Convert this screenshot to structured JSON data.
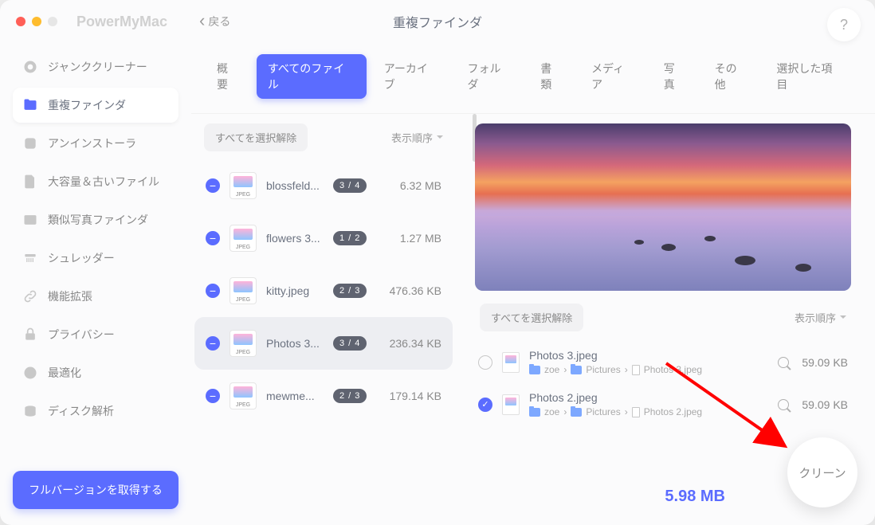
{
  "app_title": "PowerMyMac",
  "back_label": "戻る",
  "page_title": "重複ファインダ",
  "help_label": "?",
  "sidebar": {
    "items": [
      {
        "label": "ジャンククリーナー"
      },
      {
        "label": "重複ファインダ"
      },
      {
        "label": "アンインストーラ"
      },
      {
        "label": "大容量＆古いファイル"
      },
      {
        "label": "類似写真ファインダ"
      },
      {
        "label": "シュレッダー"
      },
      {
        "label": "機能拡張"
      },
      {
        "label": "プライバシー"
      },
      {
        "label": "最適化"
      },
      {
        "label": "ディスク解析"
      }
    ],
    "full_version": "フルバージョンを取得する"
  },
  "tabs": [
    "概要",
    "すべてのファイル",
    "アーカイブ",
    "フォルダ",
    "書類",
    "メディア",
    "写真",
    "その他",
    "選択した項目"
  ],
  "active_tab": 1,
  "deselect_all": "すべてを選択解除",
  "sort_label": "表示順序",
  "files": [
    {
      "name": "blossfeld...",
      "badge": "3 / 4",
      "size": "6.32 MB"
    },
    {
      "name": "flowers 3...",
      "badge": "1 / 2",
      "size": "1.27 MB"
    },
    {
      "name": "kitty.jpeg",
      "badge": "2 / 3",
      "size": "476.36 KB"
    },
    {
      "name": "Photos 3...",
      "badge": "3 / 4",
      "size": "236.34 KB"
    },
    {
      "name": "mewme...",
      "badge": "2 / 3",
      "size": "179.14 KB"
    }
  ],
  "active_file": 3,
  "duplicates": [
    {
      "name": "Photos 3.jpeg",
      "checked": false,
      "path_user": "zoe",
      "path_folder": "Pictures",
      "path_file": "Photos 3.jpeg",
      "size": "59.09 KB"
    },
    {
      "name": "Photos 2.jpeg",
      "checked": true,
      "path_user": "zoe",
      "path_folder": "Pictures",
      "path_file": "Photos 2.jpeg",
      "size": "59.09 KB"
    }
  ],
  "path_sep": "›",
  "total_size": "5.98 MB",
  "clean_label": "クリーン"
}
